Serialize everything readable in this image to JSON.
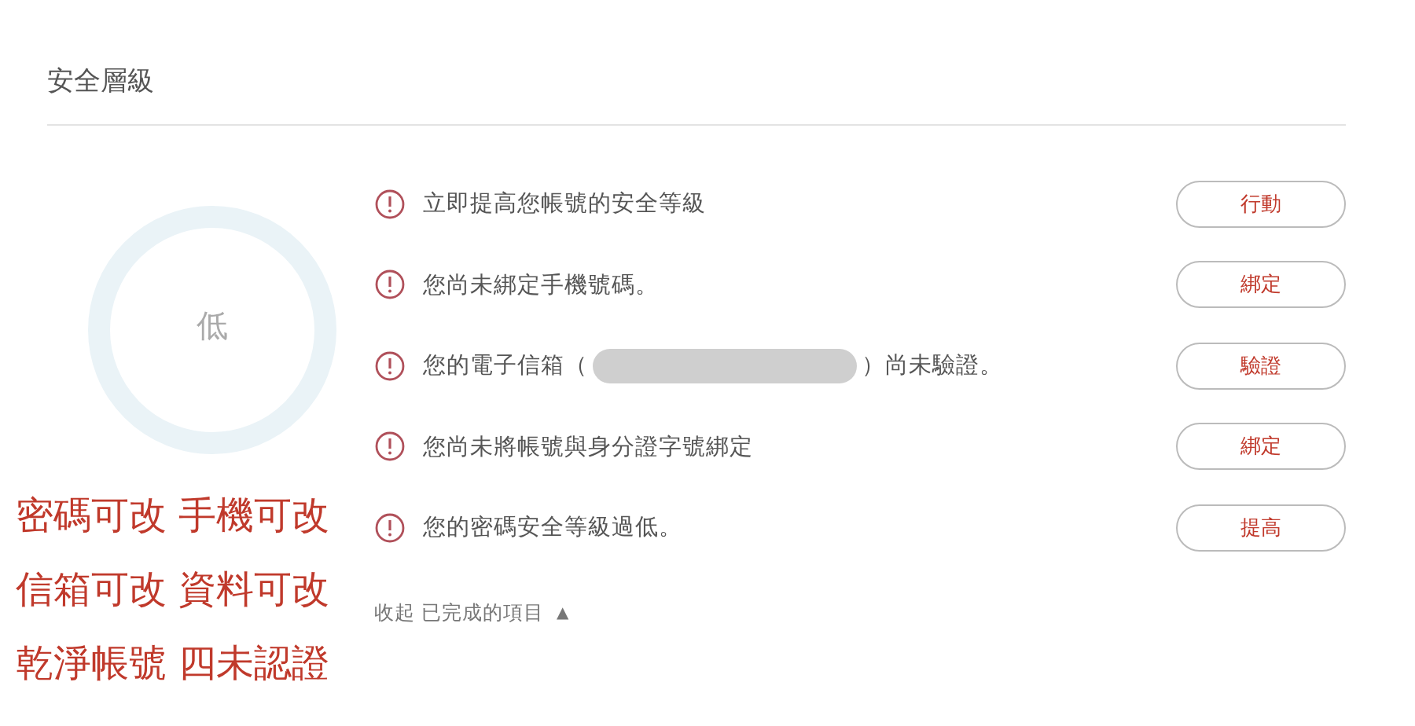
{
  "title": "安全層級",
  "gauge": {
    "label": "低"
  },
  "items": [
    {
      "kind": "plain",
      "text": "立即提高您帳號的安全等級",
      "button": "行動"
    },
    {
      "kind": "plain",
      "text": "您尚未綁定手機號碼。",
      "button": "綁定"
    },
    {
      "kind": "redacted",
      "text": "您的電子信箱（",
      "suffix": "）尚未驗證。",
      "button": "驗證"
    },
    {
      "kind": "plain",
      "text": "您尚未將帳號與身分證字號綁定",
      "button": "綁定"
    },
    {
      "kind": "plain",
      "text": "您的密碼安全等級過低。",
      "button": "提高"
    }
  ],
  "collapse": {
    "label": "收起 已完成的項目",
    "arrow": "▲"
  },
  "overlay_notes": [
    "密碼可改 手機可改",
    "信箱可改 資料可改",
    "乾淨帳號 四未認證"
  ]
}
